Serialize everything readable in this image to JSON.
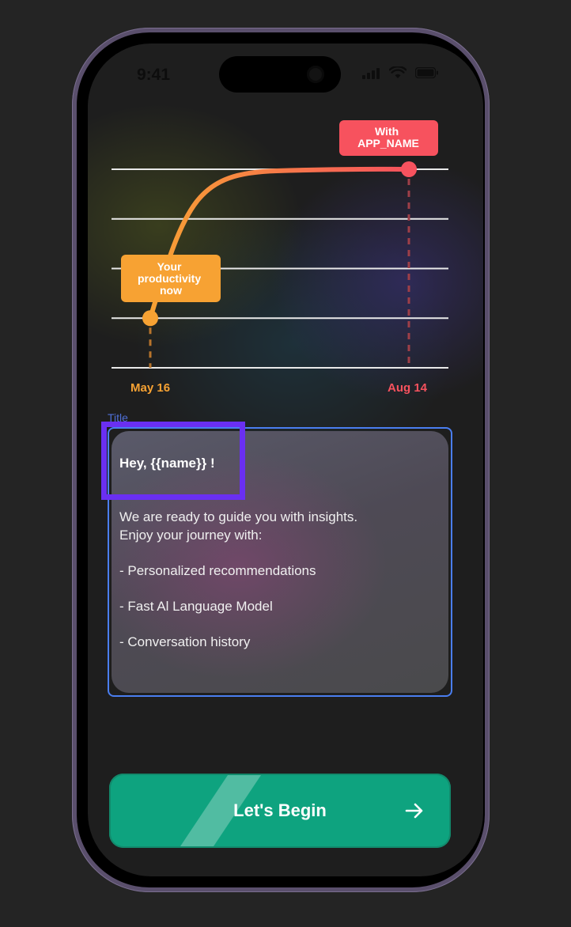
{
  "status_bar": {
    "time": "9:41",
    "icons": [
      "signal-icon",
      "wifi-icon",
      "battery-icon"
    ]
  },
  "chart_data": {
    "type": "line",
    "x": [
      "May 16",
      "Aug 14"
    ],
    "y_gridlines": 5,
    "grid": true,
    "curve": "rising ease-out",
    "series": [
      {
        "values": [
          1,
          4
        ],
        "color_start": "#f7a233",
        "color_end": "#f7525e"
      }
    ],
    "annotations": [
      {
        "point": "start",
        "label": "Your productivity now",
        "lines": [
          "Your",
          "productivity",
          "now"
        ],
        "color": "#f7a233"
      },
      {
        "point": "end",
        "label": "With APP_NAME",
        "lines": [
          "With",
          "APP_NAME"
        ],
        "color": "#f7525e"
      }
    ],
    "xlabel": "",
    "ylabel": ""
  },
  "axis": {
    "start_label": "May 16",
    "end_label": "Aug 14",
    "start_color": "#f7a233",
    "end_color": "#f7525e"
  },
  "frame": {
    "tag": "Title"
  },
  "card": {
    "greeting": "Hey, {{name}} !",
    "intro_line1": "We are ready to guide you with insights.",
    "intro_line2": "Enjoy your journey with:",
    "features": [
      "- Personalized recommendations",
      "- Fast Al Language Model",
      "- Conversation history"
    ]
  },
  "cta": {
    "label": "Let's Begin",
    "icon": "arrow-right-icon",
    "color": "#0ea37f"
  },
  "colors": {
    "background": "#242424",
    "selection": "#6a2ff2",
    "frame_outline": "#4a7ef0"
  }
}
